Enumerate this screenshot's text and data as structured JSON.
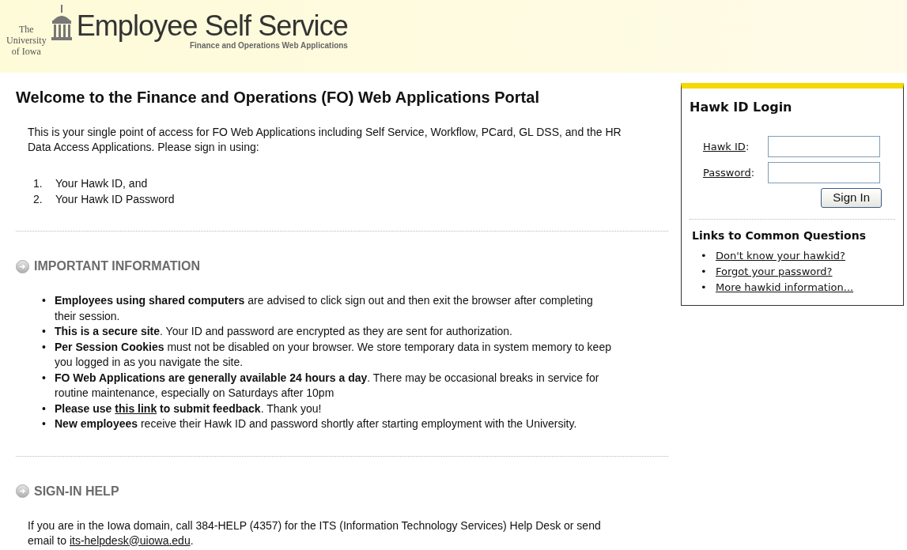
{
  "header": {
    "university": [
      "The",
      "University",
      "of Iowa"
    ],
    "title": "Employee Self Service",
    "subtitle": "Finance and Operations Web Applications"
  },
  "main": {
    "heading": "Welcome to the Finance and Operations (FO) Web Applications Portal",
    "intro": "This is your single point of access for FO Web Applications including Self Service, Workflow, PCard, GL DSS, and the HR Data Access Applications. Please sign in using:",
    "steps": [
      {
        "number": "1.",
        "text": "Your Hawk ID, and"
      },
      {
        "number": "2.",
        "text": "Your Hawk ID Password"
      }
    ],
    "sections": [
      {
        "title": "IMPORTANT INFORMATION",
        "kind": "bullets",
        "items": [
          {
            "marker": "•",
            "parts": [
              {
                "kind": "text",
                "text": "**Employees using shared computers** are advised to click sign out and then exit the browser after completing their session."
              }
            ]
          },
          {
            "marker": "•",
            "parts": [
              {
                "kind": "text",
                "text": "**This is a secure site**. Your ID and password are encrypted as they are sent for authorization."
              }
            ]
          },
          {
            "marker": "•",
            "parts": [
              {
                "kind": "text",
                "text": "**Per Session Cookies** must not be disabled on your browser. We store temporary data in system memory to keep you logged in as you navigate the site."
              }
            ]
          },
          {
            "marker": "•",
            "parts": [
              {
                "kind": "text",
                "text": "**FO Web Applications are generally available 24 hours a day**. There may be occasional breaks in service for routine maintenance, especially on Saturdays after 10pm"
              }
            ]
          },
          {
            "marker": "•",
            "parts": [
              {
                "kind": "text",
                "text": "**Please use** "
              },
              {
                "kind": "link",
                "text": "this link",
                "bold": true
              },
              {
                "kind": "text",
                "text": " **to submit feedback**. Thank you!"
              }
            ]
          },
          {
            "marker": "•",
            "parts": [
              {
                "kind": "text",
                "text": "**New employees** receive their Hawk ID and password shortly after starting employment with the University."
              }
            ]
          }
        ]
      },
      {
        "title": "SIGN-IN HELP",
        "kind": "paragraph",
        "items": [
          {
            "parts": [
              {
                "kind": "text",
                "text": "If you are in the Iowa domain, call 384-HELP (4357) for the ITS (Information Technology Services) Help Desk or send email to "
              },
              {
                "kind": "link",
                "text": "its-helpdesk@uiowa.edu",
                "bold": false
              },
              {
                "kind": "text",
                "text": "."
              }
            ]
          }
        ]
      }
    ]
  },
  "login": {
    "title": "Hawk ID Login",
    "fields": [
      {
        "label": "Hawk ID",
        "separator": ":"
      },
      {
        "label": "Password",
        "separator": ":"
      }
    ],
    "button": "Sign In",
    "links_title": "Links to Common Questions",
    "links": [
      {
        "marker": "•",
        "text": "Don't know your hawkid?"
      },
      {
        "marker": "•",
        "text": "Forgot your password?"
      },
      {
        "marker": "•",
        "text": "More hawkid information..."
      }
    ]
  }
}
